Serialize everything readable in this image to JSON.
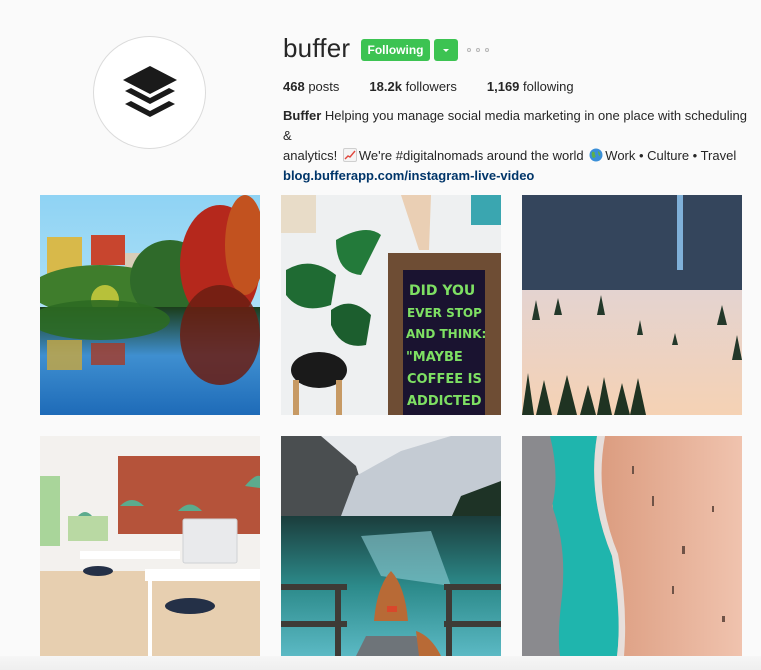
{
  "profile": {
    "username": "buffer",
    "avatar_icon": "buffer-logo-icon",
    "follow_button_label": "Following",
    "dropdown_icon": "caret-down-icon",
    "more_icon": "ellipsis-icon",
    "accent_color": "#3cc352"
  },
  "stats": [
    {
      "value": "468",
      "label": "posts"
    },
    {
      "value": "18.2k",
      "label": "followers"
    },
    {
      "value": "1,169",
      "label": "following"
    }
  ],
  "bio": {
    "name": "Buffer",
    "line1": "Helping you manage social media marketing in one place with scheduling &",
    "line2_a": "analytics!",
    "emoji1": "chart-increasing-icon",
    "line2_b": "We're #digitalnomads around the world",
    "emoji2": "globe-icon",
    "line2_c": "Work • Culture • Travel",
    "link": "blog.bufferapp.com/instagram-live-video",
    "link_color": "#003569"
  },
  "posts": [
    {
      "alt": "Autumn trees and city buildings reflected in a lake",
      "caption": ""
    },
    {
      "alt": "Monstera plant beside a chalkboard sign",
      "caption": "DID YOU EVER STOP AND THINK: \"MAYBE COFFEE IS ADDICTED TO ME?\""
    },
    {
      "alt": "Misty forest valley below a waterfall cliff",
      "caption": ""
    },
    {
      "alt": "Bright office with white desks, green lamps and brick wall",
      "caption": ""
    },
    {
      "alt": "Rowboat on a dock at a turquoise mountain lake",
      "caption": ""
    },
    {
      "alt": "Aerial view of turquoise surf on a pink sandy beach",
      "caption": ""
    }
  ]
}
